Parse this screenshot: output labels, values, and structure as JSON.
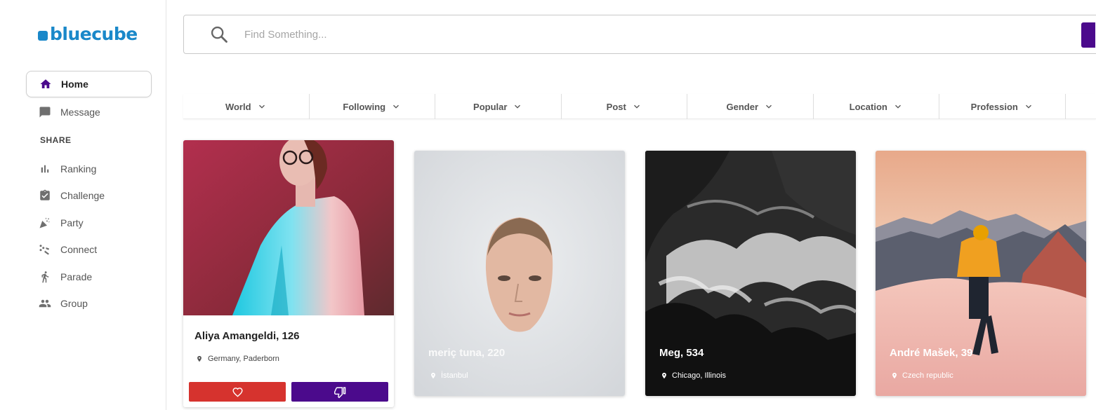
{
  "brand": {
    "name": "bluecube",
    "color": "#1a88c9"
  },
  "colors": {
    "accent": "#4b0a8c",
    "like": "#d6332e"
  },
  "sidebar": {
    "items": [
      {
        "label": "Home",
        "icon": "home-icon",
        "active": true
      },
      {
        "label": "Message",
        "icon": "message-icon"
      }
    ],
    "section_label": "SHARE",
    "share_items": [
      {
        "label": "Ranking",
        "icon": "bar-chart-icon"
      },
      {
        "label": "Challenge",
        "icon": "clipboard-check-icon"
      },
      {
        "label": "Party",
        "icon": "party-popper-icon"
      },
      {
        "label": "Connect",
        "icon": "connect-icon"
      },
      {
        "label": "Parade",
        "icon": "walking-icon"
      },
      {
        "label": "Group",
        "icon": "group-icon"
      }
    ]
  },
  "search": {
    "placeholder": "Find Something...",
    "value": ""
  },
  "filters": [
    {
      "label": "World"
    },
    {
      "label": "Following"
    },
    {
      "label": "Popular"
    },
    {
      "label": "Post"
    },
    {
      "label": "Gender"
    },
    {
      "label": "Location"
    },
    {
      "label": "Profession"
    }
  ],
  "cards": [
    {
      "name": "Aliya Amangeldi, 126",
      "location": "Germany, Paderborn"
    },
    {
      "name": "meriç tuna, 220",
      "location": "İstanbul"
    },
    {
      "name": "Meg, 534",
      "location": "Chicago, Illinois"
    },
    {
      "name": "André Mašek, 39",
      "location": "Czech republic"
    }
  ]
}
